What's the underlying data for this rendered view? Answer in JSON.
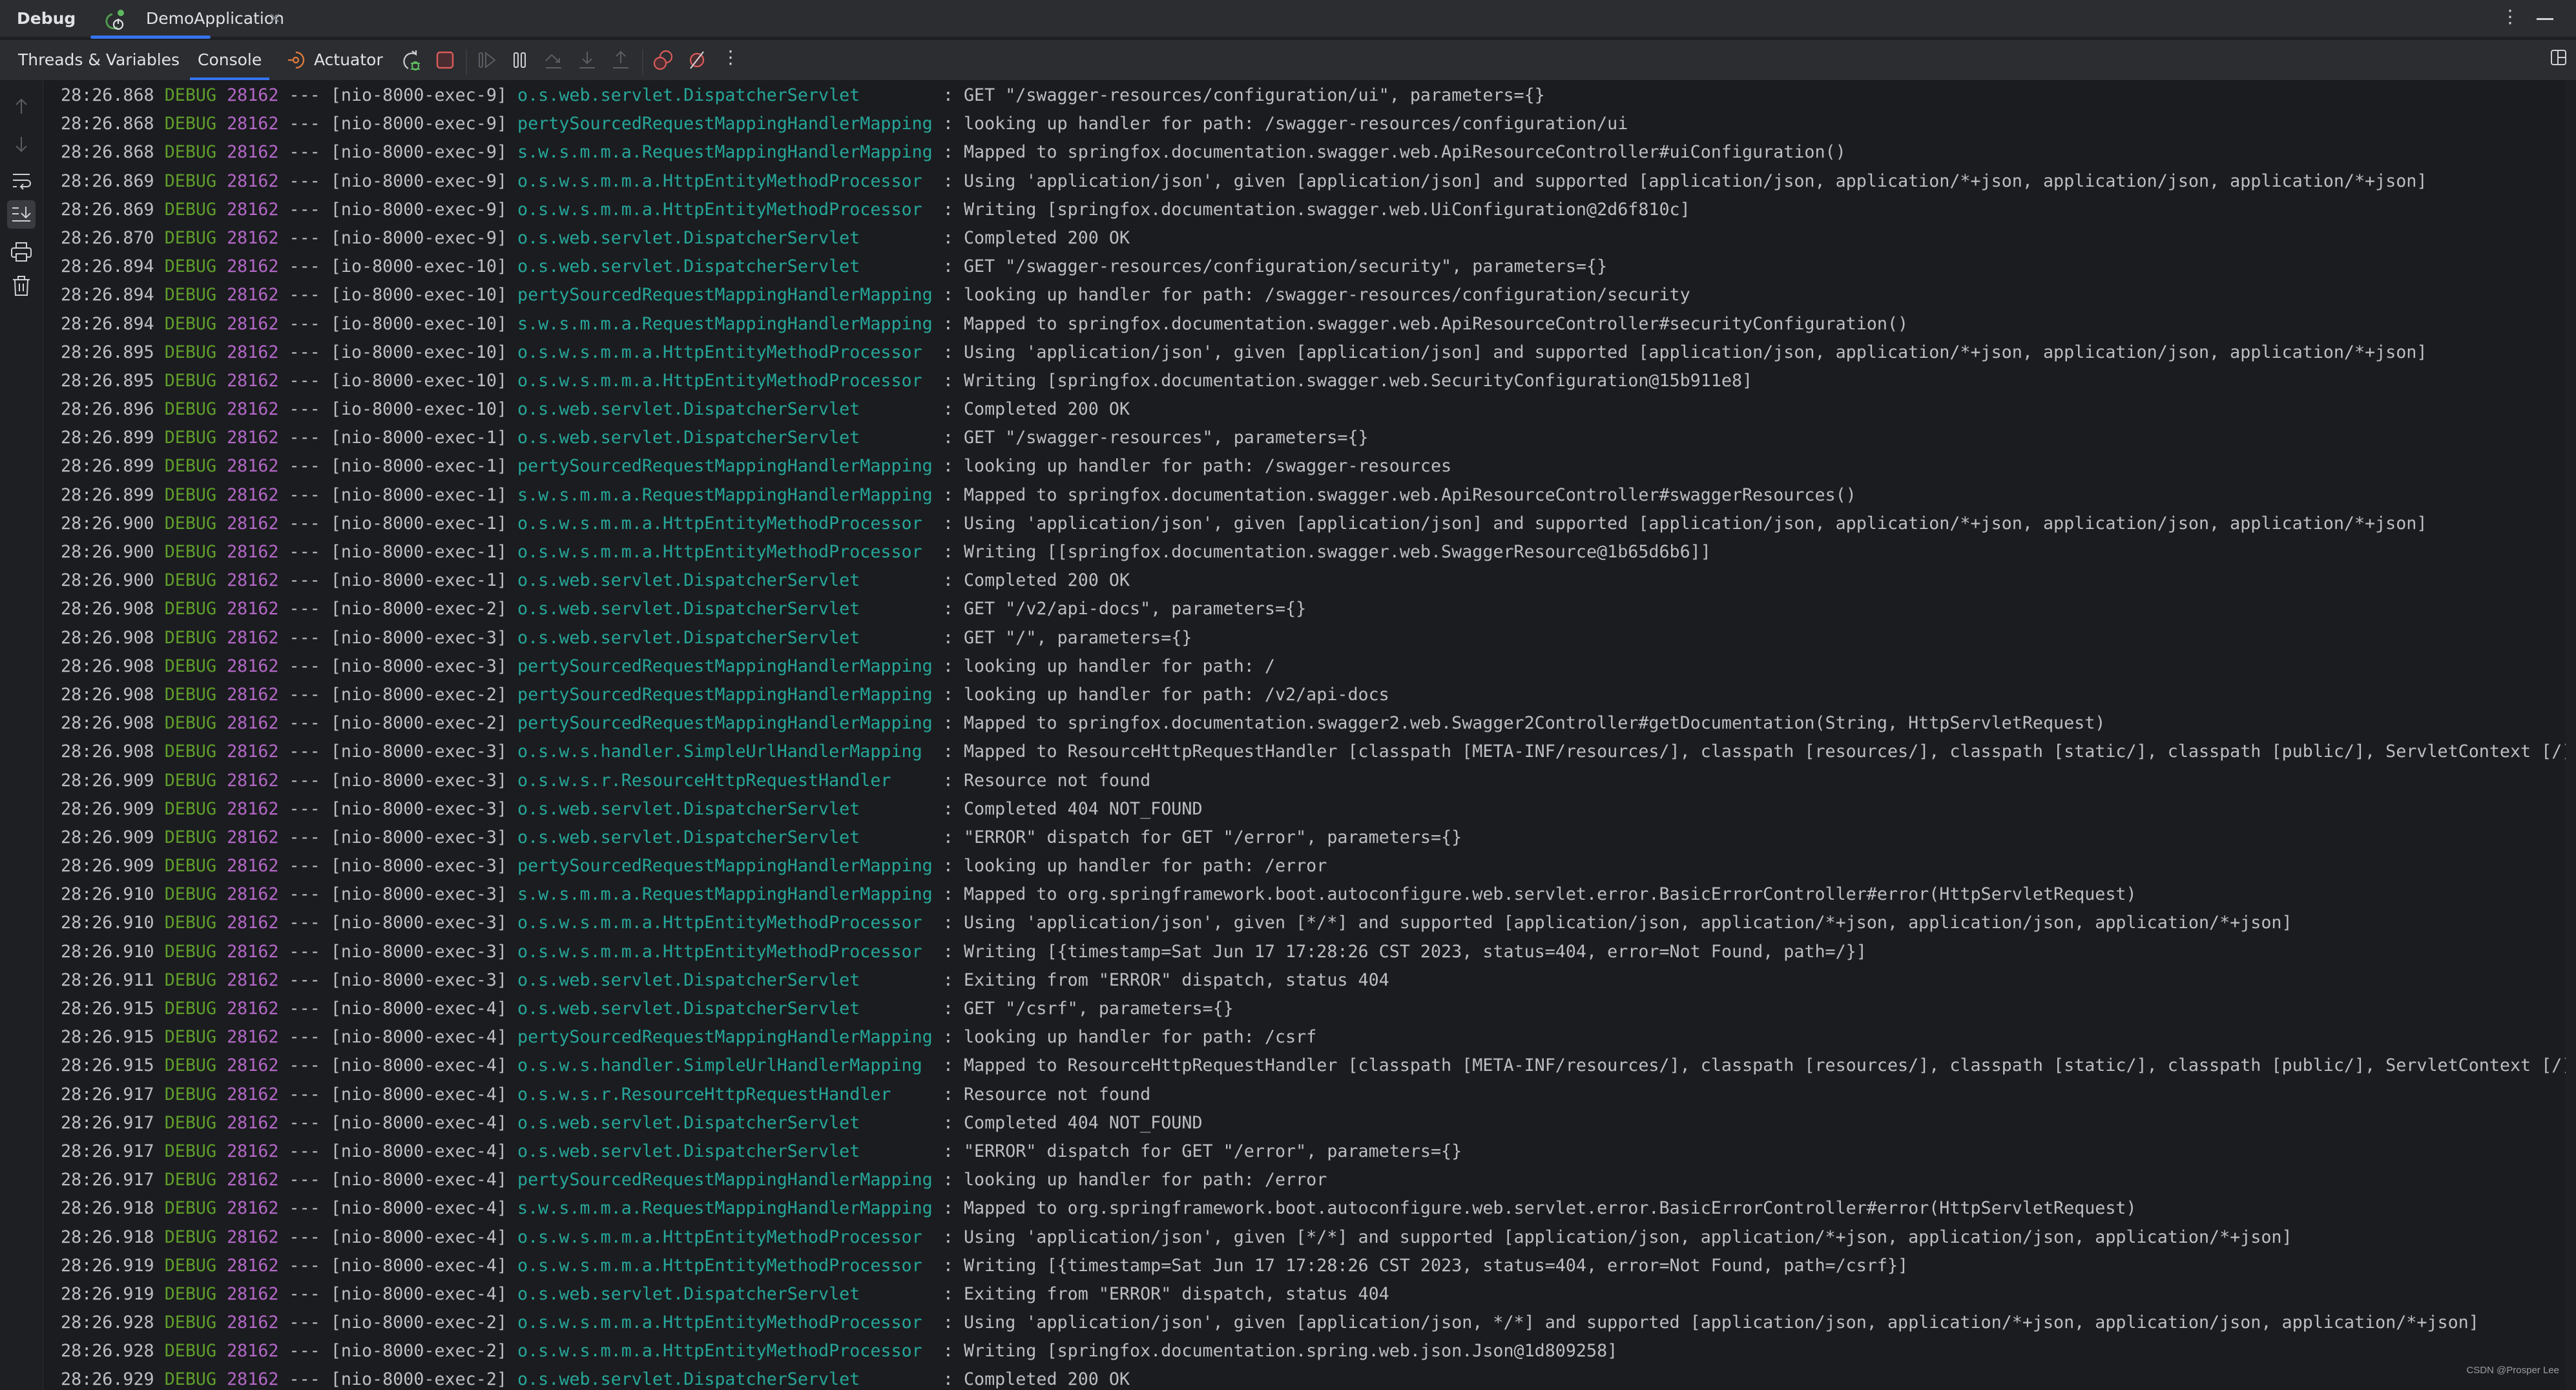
{
  "header": {
    "title": "Debug",
    "session_tab": "DemoApplication",
    "close_glyph": "×"
  },
  "toolbar": {
    "tabs": [
      {
        "label": "Threads & Variables",
        "active": false
      },
      {
        "label": "Console",
        "active": true
      },
      {
        "label": "Actuator",
        "active": false
      }
    ],
    "icons": [
      "rerun-debug-icon",
      "stop-icon",
      "resume-icon",
      "pause-icon",
      "step-over-icon",
      "step-into-icon",
      "step-out-icon",
      "view-breakpoints-icon",
      "mute-breakpoints-icon",
      "more-icon"
    ]
  },
  "gutter": {
    "icons": [
      "scroll-up-icon",
      "scroll-down-icon",
      "soft-wrap-icon",
      "scroll-to-end-icon",
      "print-icon",
      "clear-all-icon"
    ]
  },
  "colors": {
    "accent": "#3574f0",
    "level": "#5f9e2b",
    "pid": "#b267c6",
    "logger": "#26a69a",
    "text": "#bcbec4",
    "stop_red": "#db5c5c",
    "debug_green": "#5fb85f"
  },
  "log": {
    "lines": [
      {
        "time": "28:26.868",
        "level": "DEBUG",
        "pid": "28162",
        "sep": "---",
        "thread": "[nio-8000-exec-9]",
        "logger": "o.s.web.servlet.DispatcherServlet       ",
        "msg": ": GET \"/swagger-resources/configuration/ui\", parameters={}"
      },
      {
        "time": "28:26.868",
        "level": "DEBUG",
        "pid": "28162",
        "sep": "---",
        "thread": "[nio-8000-exec-9]",
        "logger": "pertySourcedRequestMappingHandlerMapping",
        "msg": ": looking up handler for path: /swagger-resources/configuration/ui"
      },
      {
        "time": "28:26.868",
        "level": "DEBUG",
        "pid": "28162",
        "sep": "---",
        "thread": "[nio-8000-exec-9]",
        "logger": "s.w.s.m.m.a.RequestMappingHandlerMapping",
        "msg": ": Mapped to springfox.documentation.swagger.web.ApiResourceController#uiConfiguration()"
      },
      {
        "time": "28:26.869",
        "level": "DEBUG",
        "pid": "28162",
        "sep": "---",
        "thread": "[nio-8000-exec-9]",
        "logger": "o.s.w.s.m.m.a.HttpEntityMethodProcessor ",
        "msg": ": Using 'application/json', given [application/json] and supported [application/json, application/*+json, application/json, application/*+json]"
      },
      {
        "time": "28:26.869",
        "level": "DEBUG",
        "pid": "28162",
        "sep": "---",
        "thread": "[nio-8000-exec-9]",
        "logger": "o.s.w.s.m.m.a.HttpEntityMethodProcessor ",
        "msg": ": Writing [springfox.documentation.swagger.web.UiConfiguration@2d6f810c]"
      },
      {
        "time": "28:26.870",
        "level": "DEBUG",
        "pid": "28162",
        "sep": "---",
        "thread": "[nio-8000-exec-9]",
        "logger": "o.s.web.servlet.DispatcherServlet       ",
        "msg": ": Completed 200 OK"
      },
      {
        "time": "28:26.894",
        "level": "DEBUG",
        "pid": "28162",
        "sep": "---",
        "thread": "[io-8000-exec-10]",
        "logger": "o.s.web.servlet.DispatcherServlet       ",
        "msg": ": GET \"/swagger-resources/configuration/security\", parameters={}"
      },
      {
        "time": "28:26.894",
        "level": "DEBUG",
        "pid": "28162",
        "sep": "---",
        "thread": "[io-8000-exec-10]",
        "logger": "pertySourcedRequestMappingHandlerMapping",
        "msg": ": looking up handler for path: /swagger-resources/configuration/security"
      },
      {
        "time": "28:26.894",
        "level": "DEBUG",
        "pid": "28162",
        "sep": "---",
        "thread": "[io-8000-exec-10]",
        "logger": "s.w.s.m.m.a.RequestMappingHandlerMapping",
        "msg": ": Mapped to springfox.documentation.swagger.web.ApiResourceController#securityConfiguration()"
      },
      {
        "time": "28:26.895",
        "level": "DEBUG",
        "pid": "28162",
        "sep": "---",
        "thread": "[io-8000-exec-10]",
        "logger": "o.s.w.s.m.m.a.HttpEntityMethodProcessor ",
        "msg": ": Using 'application/json', given [application/json] and supported [application/json, application/*+json, application/json, application/*+json]"
      },
      {
        "time": "28:26.895",
        "level": "DEBUG",
        "pid": "28162",
        "sep": "---",
        "thread": "[io-8000-exec-10]",
        "logger": "o.s.w.s.m.m.a.HttpEntityMethodProcessor ",
        "msg": ": Writing [springfox.documentation.swagger.web.SecurityConfiguration@15b911e8]"
      },
      {
        "time": "28:26.896",
        "level": "DEBUG",
        "pid": "28162",
        "sep": "---",
        "thread": "[io-8000-exec-10]",
        "logger": "o.s.web.servlet.DispatcherServlet       ",
        "msg": ": Completed 200 OK"
      },
      {
        "time": "28:26.899",
        "level": "DEBUG",
        "pid": "28162",
        "sep": "---",
        "thread": "[nio-8000-exec-1]",
        "logger": "o.s.web.servlet.DispatcherServlet       ",
        "msg": ": GET \"/swagger-resources\", parameters={}"
      },
      {
        "time": "28:26.899",
        "level": "DEBUG",
        "pid": "28162",
        "sep": "---",
        "thread": "[nio-8000-exec-1]",
        "logger": "pertySourcedRequestMappingHandlerMapping",
        "msg": ": looking up handler for path: /swagger-resources"
      },
      {
        "time": "28:26.899",
        "level": "DEBUG",
        "pid": "28162",
        "sep": "---",
        "thread": "[nio-8000-exec-1]",
        "logger": "s.w.s.m.m.a.RequestMappingHandlerMapping",
        "msg": ": Mapped to springfox.documentation.swagger.web.ApiResourceController#swaggerResources()"
      },
      {
        "time": "28:26.900",
        "level": "DEBUG",
        "pid": "28162",
        "sep": "---",
        "thread": "[nio-8000-exec-1]",
        "logger": "o.s.w.s.m.m.a.HttpEntityMethodProcessor ",
        "msg": ": Using 'application/json', given [application/json] and supported [application/json, application/*+json, application/json, application/*+json]"
      },
      {
        "time": "28:26.900",
        "level": "DEBUG",
        "pid": "28162",
        "sep": "---",
        "thread": "[nio-8000-exec-1]",
        "logger": "o.s.w.s.m.m.a.HttpEntityMethodProcessor ",
        "msg": ": Writing [[springfox.documentation.swagger.web.SwaggerResource@1b65d6b6]]"
      },
      {
        "time": "28:26.900",
        "level": "DEBUG",
        "pid": "28162",
        "sep": "---",
        "thread": "[nio-8000-exec-1]",
        "logger": "o.s.web.servlet.DispatcherServlet       ",
        "msg": ": Completed 200 OK"
      },
      {
        "time": "28:26.908",
        "level": "DEBUG",
        "pid": "28162",
        "sep": "---",
        "thread": "[nio-8000-exec-2]",
        "logger": "o.s.web.servlet.DispatcherServlet       ",
        "msg": ": GET \"/v2/api-docs\", parameters={}"
      },
      {
        "time": "28:26.908",
        "level": "DEBUG",
        "pid": "28162",
        "sep": "---",
        "thread": "[nio-8000-exec-3]",
        "logger": "o.s.web.servlet.DispatcherServlet       ",
        "msg": ": GET \"/\", parameters={}"
      },
      {
        "time": "28:26.908",
        "level": "DEBUG",
        "pid": "28162",
        "sep": "---",
        "thread": "[nio-8000-exec-3]",
        "logger": "pertySourcedRequestMappingHandlerMapping",
        "msg": ": looking up handler for path: /"
      },
      {
        "time": "28:26.908",
        "level": "DEBUG",
        "pid": "28162",
        "sep": "---",
        "thread": "[nio-8000-exec-2]",
        "logger": "pertySourcedRequestMappingHandlerMapping",
        "msg": ": looking up handler for path: /v2/api-docs"
      },
      {
        "time": "28:26.908",
        "level": "DEBUG",
        "pid": "28162",
        "sep": "---",
        "thread": "[nio-8000-exec-2]",
        "logger": "pertySourcedRequestMappingHandlerMapping",
        "msg": ": Mapped to springfox.documentation.swagger2.web.Swagger2Controller#getDocumentation(String, HttpServletRequest)"
      },
      {
        "time": "28:26.908",
        "level": "DEBUG",
        "pid": "28162",
        "sep": "---",
        "thread": "[nio-8000-exec-3]",
        "logger": "o.s.w.s.handler.SimpleUrlHandlerMapping ",
        "msg": ": Mapped to ResourceHttpRequestHandler [classpath [META-INF/resources/], classpath [resources/], classpath [static/], classpath [public/], ServletContext [/]]"
      },
      {
        "time": "28:26.909",
        "level": "DEBUG",
        "pid": "28162",
        "sep": "---",
        "thread": "[nio-8000-exec-3]",
        "logger": "o.s.w.s.r.ResourceHttpRequestHandler    ",
        "msg": ": Resource not found"
      },
      {
        "time": "28:26.909",
        "level": "DEBUG",
        "pid": "28162",
        "sep": "---",
        "thread": "[nio-8000-exec-3]",
        "logger": "o.s.web.servlet.DispatcherServlet       ",
        "msg": ": Completed 404 NOT_FOUND"
      },
      {
        "time": "28:26.909",
        "level": "DEBUG",
        "pid": "28162",
        "sep": "---",
        "thread": "[nio-8000-exec-3]",
        "logger": "o.s.web.servlet.DispatcherServlet       ",
        "msg": ": \"ERROR\" dispatch for GET \"/error\", parameters={}"
      },
      {
        "time": "28:26.909",
        "level": "DEBUG",
        "pid": "28162",
        "sep": "---",
        "thread": "[nio-8000-exec-3]",
        "logger": "pertySourcedRequestMappingHandlerMapping",
        "msg": ": looking up handler for path: /error"
      },
      {
        "time": "28:26.910",
        "level": "DEBUG",
        "pid": "28162",
        "sep": "---",
        "thread": "[nio-8000-exec-3]",
        "logger": "s.w.s.m.m.a.RequestMappingHandlerMapping",
        "msg": ": Mapped to org.springframework.boot.autoconfigure.web.servlet.error.BasicErrorController#error(HttpServletRequest)"
      },
      {
        "time": "28:26.910",
        "level": "DEBUG",
        "pid": "28162",
        "sep": "---",
        "thread": "[nio-8000-exec-3]",
        "logger": "o.s.w.s.m.m.a.HttpEntityMethodProcessor ",
        "msg": ": Using 'application/json', given [*/*] and supported [application/json, application/*+json, application/json, application/*+json]"
      },
      {
        "time": "28:26.910",
        "level": "DEBUG",
        "pid": "28162",
        "sep": "---",
        "thread": "[nio-8000-exec-3]",
        "logger": "o.s.w.s.m.m.a.HttpEntityMethodProcessor ",
        "msg": ": Writing [{timestamp=Sat Jun 17 17:28:26 CST 2023, status=404, error=Not Found, path=/}]"
      },
      {
        "time": "28:26.911",
        "level": "DEBUG",
        "pid": "28162",
        "sep": "---",
        "thread": "[nio-8000-exec-3]",
        "logger": "o.s.web.servlet.DispatcherServlet       ",
        "msg": ": Exiting from \"ERROR\" dispatch, status 404"
      },
      {
        "time": "28:26.915",
        "level": "DEBUG",
        "pid": "28162",
        "sep": "---",
        "thread": "[nio-8000-exec-4]",
        "logger": "o.s.web.servlet.DispatcherServlet       ",
        "msg": ": GET \"/csrf\", parameters={}"
      },
      {
        "time": "28:26.915",
        "level": "DEBUG",
        "pid": "28162",
        "sep": "---",
        "thread": "[nio-8000-exec-4]",
        "logger": "pertySourcedRequestMappingHandlerMapping",
        "msg": ": looking up handler for path: /csrf"
      },
      {
        "time": "28:26.915",
        "level": "DEBUG",
        "pid": "28162",
        "sep": "---",
        "thread": "[nio-8000-exec-4]",
        "logger": "o.s.w.s.handler.SimpleUrlHandlerMapping ",
        "msg": ": Mapped to ResourceHttpRequestHandler [classpath [META-INF/resources/], classpath [resources/], classpath [static/], classpath [public/], ServletContext [/]]"
      },
      {
        "time": "28:26.917",
        "level": "DEBUG",
        "pid": "28162",
        "sep": "---",
        "thread": "[nio-8000-exec-4]",
        "logger": "o.s.w.s.r.ResourceHttpRequestHandler    ",
        "msg": ": Resource not found"
      },
      {
        "time": "28:26.917",
        "level": "DEBUG",
        "pid": "28162",
        "sep": "---",
        "thread": "[nio-8000-exec-4]",
        "logger": "o.s.web.servlet.DispatcherServlet       ",
        "msg": ": Completed 404 NOT_FOUND"
      },
      {
        "time": "28:26.917",
        "level": "DEBUG",
        "pid": "28162",
        "sep": "---",
        "thread": "[nio-8000-exec-4]",
        "logger": "o.s.web.servlet.DispatcherServlet       ",
        "msg": ": \"ERROR\" dispatch for GET \"/error\", parameters={}"
      },
      {
        "time": "28:26.917",
        "level": "DEBUG",
        "pid": "28162",
        "sep": "---",
        "thread": "[nio-8000-exec-4]",
        "logger": "pertySourcedRequestMappingHandlerMapping",
        "msg": ": looking up handler for path: /error"
      },
      {
        "time": "28:26.918",
        "level": "DEBUG",
        "pid": "28162",
        "sep": "---",
        "thread": "[nio-8000-exec-4]",
        "logger": "s.w.s.m.m.a.RequestMappingHandlerMapping",
        "msg": ": Mapped to org.springframework.boot.autoconfigure.web.servlet.error.BasicErrorController#error(HttpServletRequest)"
      },
      {
        "time": "28:26.918",
        "level": "DEBUG",
        "pid": "28162",
        "sep": "---",
        "thread": "[nio-8000-exec-4]",
        "logger": "o.s.w.s.m.m.a.HttpEntityMethodProcessor ",
        "msg": ": Using 'application/json', given [*/*] and supported [application/json, application/*+json, application/json, application/*+json]"
      },
      {
        "time": "28:26.919",
        "level": "DEBUG",
        "pid": "28162",
        "sep": "---",
        "thread": "[nio-8000-exec-4]",
        "logger": "o.s.w.s.m.m.a.HttpEntityMethodProcessor ",
        "msg": ": Writing [{timestamp=Sat Jun 17 17:28:26 CST 2023, status=404, error=Not Found, path=/csrf}]"
      },
      {
        "time": "28:26.919",
        "level": "DEBUG",
        "pid": "28162",
        "sep": "---",
        "thread": "[nio-8000-exec-4]",
        "logger": "o.s.web.servlet.DispatcherServlet       ",
        "msg": ": Exiting from \"ERROR\" dispatch, status 404"
      },
      {
        "time": "28:26.928",
        "level": "DEBUG",
        "pid": "28162",
        "sep": "---",
        "thread": "[nio-8000-exec-2]",
        "logger": "o.s.w.s.m.m.a.HttpEntityMethodProcessor ",
        "msg": ": Using 'application/json', given [application/json, */*] and supported [application/json, application/*+json, application/json, application/*+json]"
      },
      {
        "time": "28:26.928",
        "level": "DEBUG",
        "pid": "28162",
        "sep": "---",
        "thread": "[nio-8000-exec-2]",
        "logger": "o.s.w.s.m.m.a.HttpEntityMethodProcessor ",
        "msg": ": Writing [springfox.documentation.spring.web.json.Json@1d809258]"
      },
      {
        "time": "28:26.929",
        "level": "DEBUG",
        "pid": "28162",
        "sep": "---",
        "thread": "[nio-8000-exec-2]",
        "logger": "o.s.web.servlet.DispatcherServlet       ",
        "msg": ": Completed 200 OK"
      }
    ]
  },
  "watermark": "CSDN @Prosper Lee"
}
